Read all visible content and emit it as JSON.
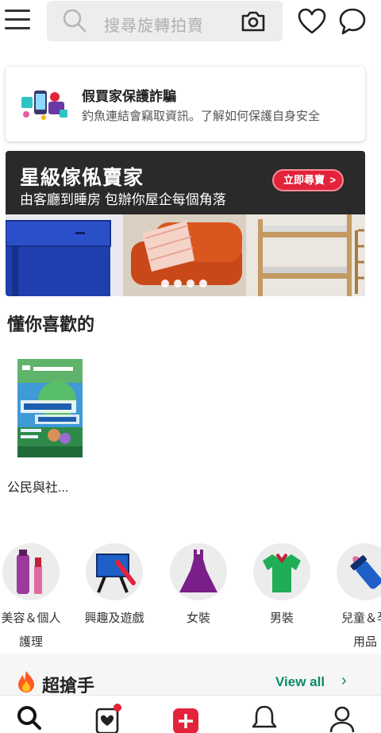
{
  "header": {
    "search_placeholder": "搜尋旋轉拍賣",
    "menu_icon": "hamburger-menu-icon",
    "camera_icon": "camera-icon",
    "favorites_icon": "heart-icon",
    "chat_icon": "chat-bubble-icon"
  },
  "safety_notice": {
    "title": "假買家保護詐騙",
    "description": "釣魚連結會竊取資訊。了解如何保護自身安全"
  },
  "banner": {
    "title": "星級傢俬賣家",
    "subtitle": "由客廳到睡房 包辦你屋企每個角落",
    "cta_label": "立即尋寶",
    "cta_arrow": ">",
    "slide_count": 4,
    "accent_color": "#e2233a"
  },
  "recommendations": {
    "title": "懂你喜歡的",
    "items": [
      {
        "name": "公民與社..."
      }
    ]
  },
  "categories": [
    {
      "label_line1": "美容＆個人",
      "label_line2": "護理",
      "icon": "cosmetics-icon"
    },
    {
      "label_line1": "興趣及遊戲",
      "label_line2": "",
      "icon": "easel-paintbrush-icon"
    },
    {
      "label_line1": "女裝",
      "label_line2": "",
      "icon": "dress-icon"
    },
    {
      "label_line1": "男裝",
      "label_line2": "",
      "icon": "tshirt-icon"
    },
    {
      "label_line1": "兒童＆孕",
      "label_line2": "用品",
      "icon": "baby-bottle-icon"
    }
  ],
  "deals": {
    "title": "超搶手",
    "view_all": "View all",
    "chevron": "›",
    "accent_color": "#0a8a6a"
  },
  "bottom_nav": {
    "items": [
      {
        "icon": "search-icon"
      },
      {
        "icon": "liked-items-icon"
      },
      {
        "icon": "sell-plus-icon"
      },
      {
        "icon": "notification-bell-icon"
      },
      {
        "icon": "profile-icon"
      }
    ],
    "brand_color": "#e2233a"
  }
}
